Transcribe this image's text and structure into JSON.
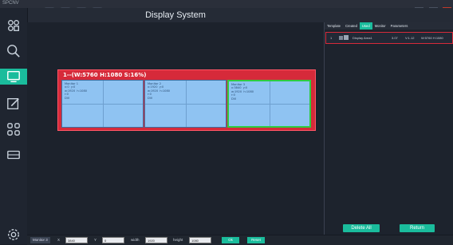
{
  "window": {
    "app_name": "SPCNV",
    "title": "Display System"
  },
  "colors": {
    "accent": "#1abc9c",
    "screen": "#d62a3a",
    "monitor": "#8fc3f2",
    "selected": "#2ecc40"
  },
  "sidebar": {
    "items": [
      {
        "icon": "scaler-icon",
        "active": false
      },
      {
        "icon": "search-icon",
        "active": false
      },
      {
        "icon": "monitor-icon",
        "active": true
      },
      {
        "icon": "edit-icon",
        "active": false
      },
      {
        "icon": "grid-icon",
        "active": false
      },
      {
        "icon": "device-icon",
        "active": false
      },
      {
        "icon": "settings-icon",
        "active": false
      }
    ]
  },
  "screen": {
    "label": "1--(W:5760 H:1080 S:16%)",
    "monitors": [
      {
        "info": "Monitor 1\nx:0  y:0\nw:1920  h:1080\nr:0\nDVI"
      },
      {
        "info": "Monitor 2\nx:1920  y:0\nw:1920  h:1080\nr:0\nDVI"
      },
      {
        "info": "Monitor 3\nx:3840  y:0\nw:1920  h:1080\nr:0\nDVI"
      }
    ]
  },
  "panel": {
    "tabs": [
      "Template",
      "Created",
      "Used",
      "Monitor",
      "Parameters"
    ],
    "active_tab": "Used",
    "rows": [
      {
        "index": "1",
        "name": "Display Area1",
        "v1": "3.07",
        "v2": "V:1.12",
        "size": "W:5760 H:1080"
      }
    ],
    "delete_all": "Delete All",
    "return": "Return"
  },
  "bottom": {
    "monitor_label": "Monitor 3",
    "x_label": "X",
    "x_value": "3840",
    "y_label": "Y",
    "y_value": "0",
    "width_label": "width",
    "width_value": "1920",
    "height_label": "height",
    "height_value": "1080",
    "ok": "Ok",
    "reset": "Reset"
  }
}
